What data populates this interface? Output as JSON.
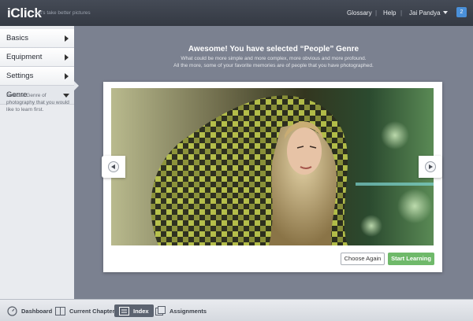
{
  "header": {
    "app_name": "iClick",
    "tagline": "Let's take better pictures",
    "links": [
      "Glossary",
      "Help"
    ],
    "separator": "|",
    "user_name": "Jai Pandya",
    "notification_count": "2"
  },
  "sidebar": {
    "items": [
      {
        "label": "Basics"
      },
      {
        "label": "Equipment"
      },
      {
        "label": "Settings"
      },
      {
        "label": "Genre"
      }
    ],
    "active_description": "Select a Genre of photography that you would like to learn first."
  },
  "main": {
    "headline": "Awesome! You have selected “People” Genre",
    "subline_1": "What could be more simple and more complex, more obvious and more profound.",
    "subline_2": "All the more, some of your favorite memories are of people that you have photographed.",
    "choose_again_label": "Choose Again",
    "start_learning_label": "Start Learning"
  },
  "bottombar": {
    "items": [
      {
        "label": "Dashboard",
        "icon": "dashboard-icon"
      },
      {
        "label": "Current Chapter",
        "icon": "book-icon"
      },
      {
        "label": "Index",
        "icon": "index-icon"
      },
      {
        "label": "Assignments",
        "icon": "assignments-icon"
      }
    ],
    "active": "Index"
  },
  "colors": {
    "accent": "#4a90d9",
    "start_button": "#6fb96a",
    "background": "#7b8190"
  }
}
